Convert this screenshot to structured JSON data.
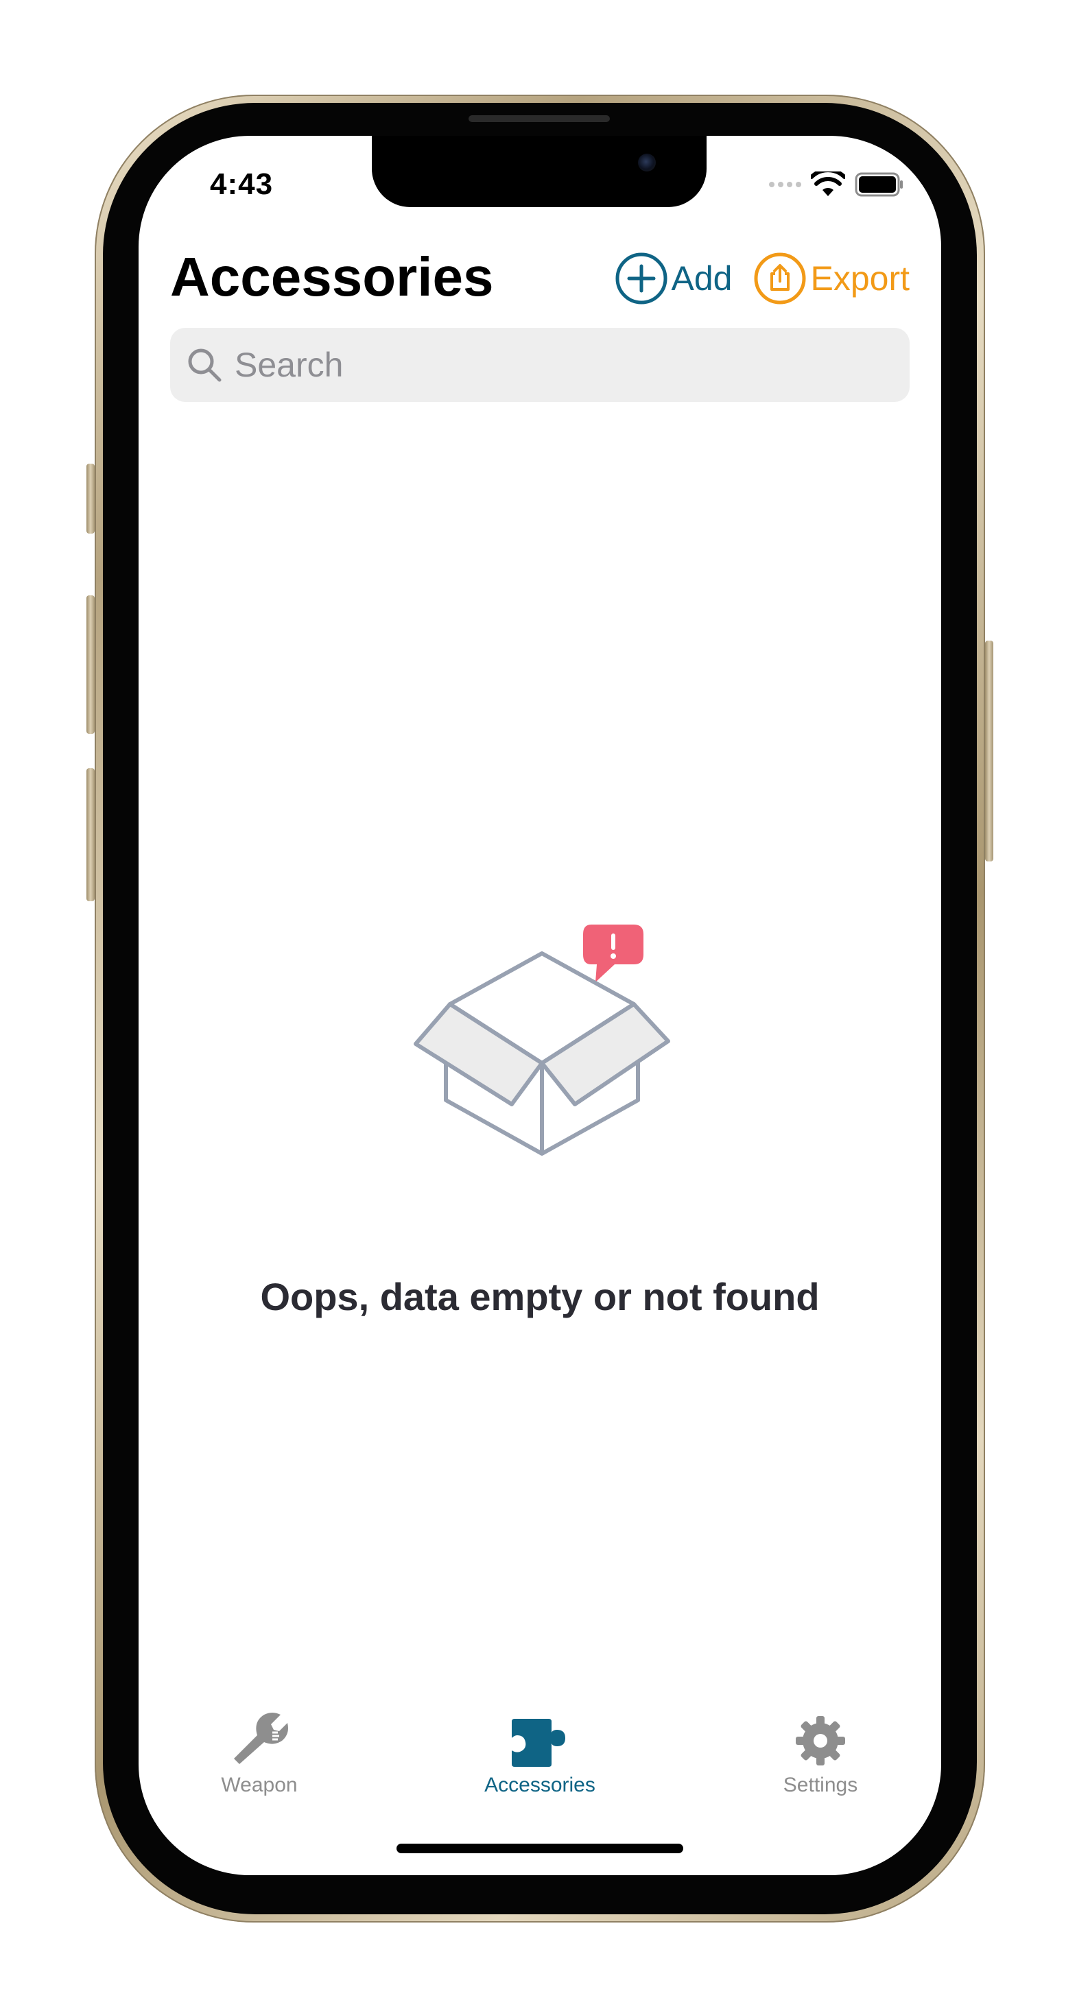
{
  "status_bar": {
    "time": "4:43"
  },
  "header": {
    "title": "Accessories",
    "add_label": "Add",
    "export_label": "Export"
  },
  "search": {
    "placeholder": "Search",
    "value": ""
  },
  "empty_state": {
    "message": "Oops, data empty or not found",
    "icon": "empty-box-icon",
    "badge_icon": "alert-bubble-icon"
  },
  "tabs": [
    {
      "label": "Weapon",
      "icon": "wrench-icon",
      "selected": false
    },
    {
      "label": "Accessories",
      "icon": "puzzle-icon",
      "selected": true
    },
    {
      "label": "Settings",
      "icon": "gear-icon",
      "selected": false
    }
  ],
  "colors": {
    "accent": "#0f6485",
    "export": "#f29a17",
    "tab_inactive": "#8e8e8e",
    "badge": "#f06277",
    "illustration_stroke": "#98a1b1",
    "search_background": "#eeeeee"
  }
}
